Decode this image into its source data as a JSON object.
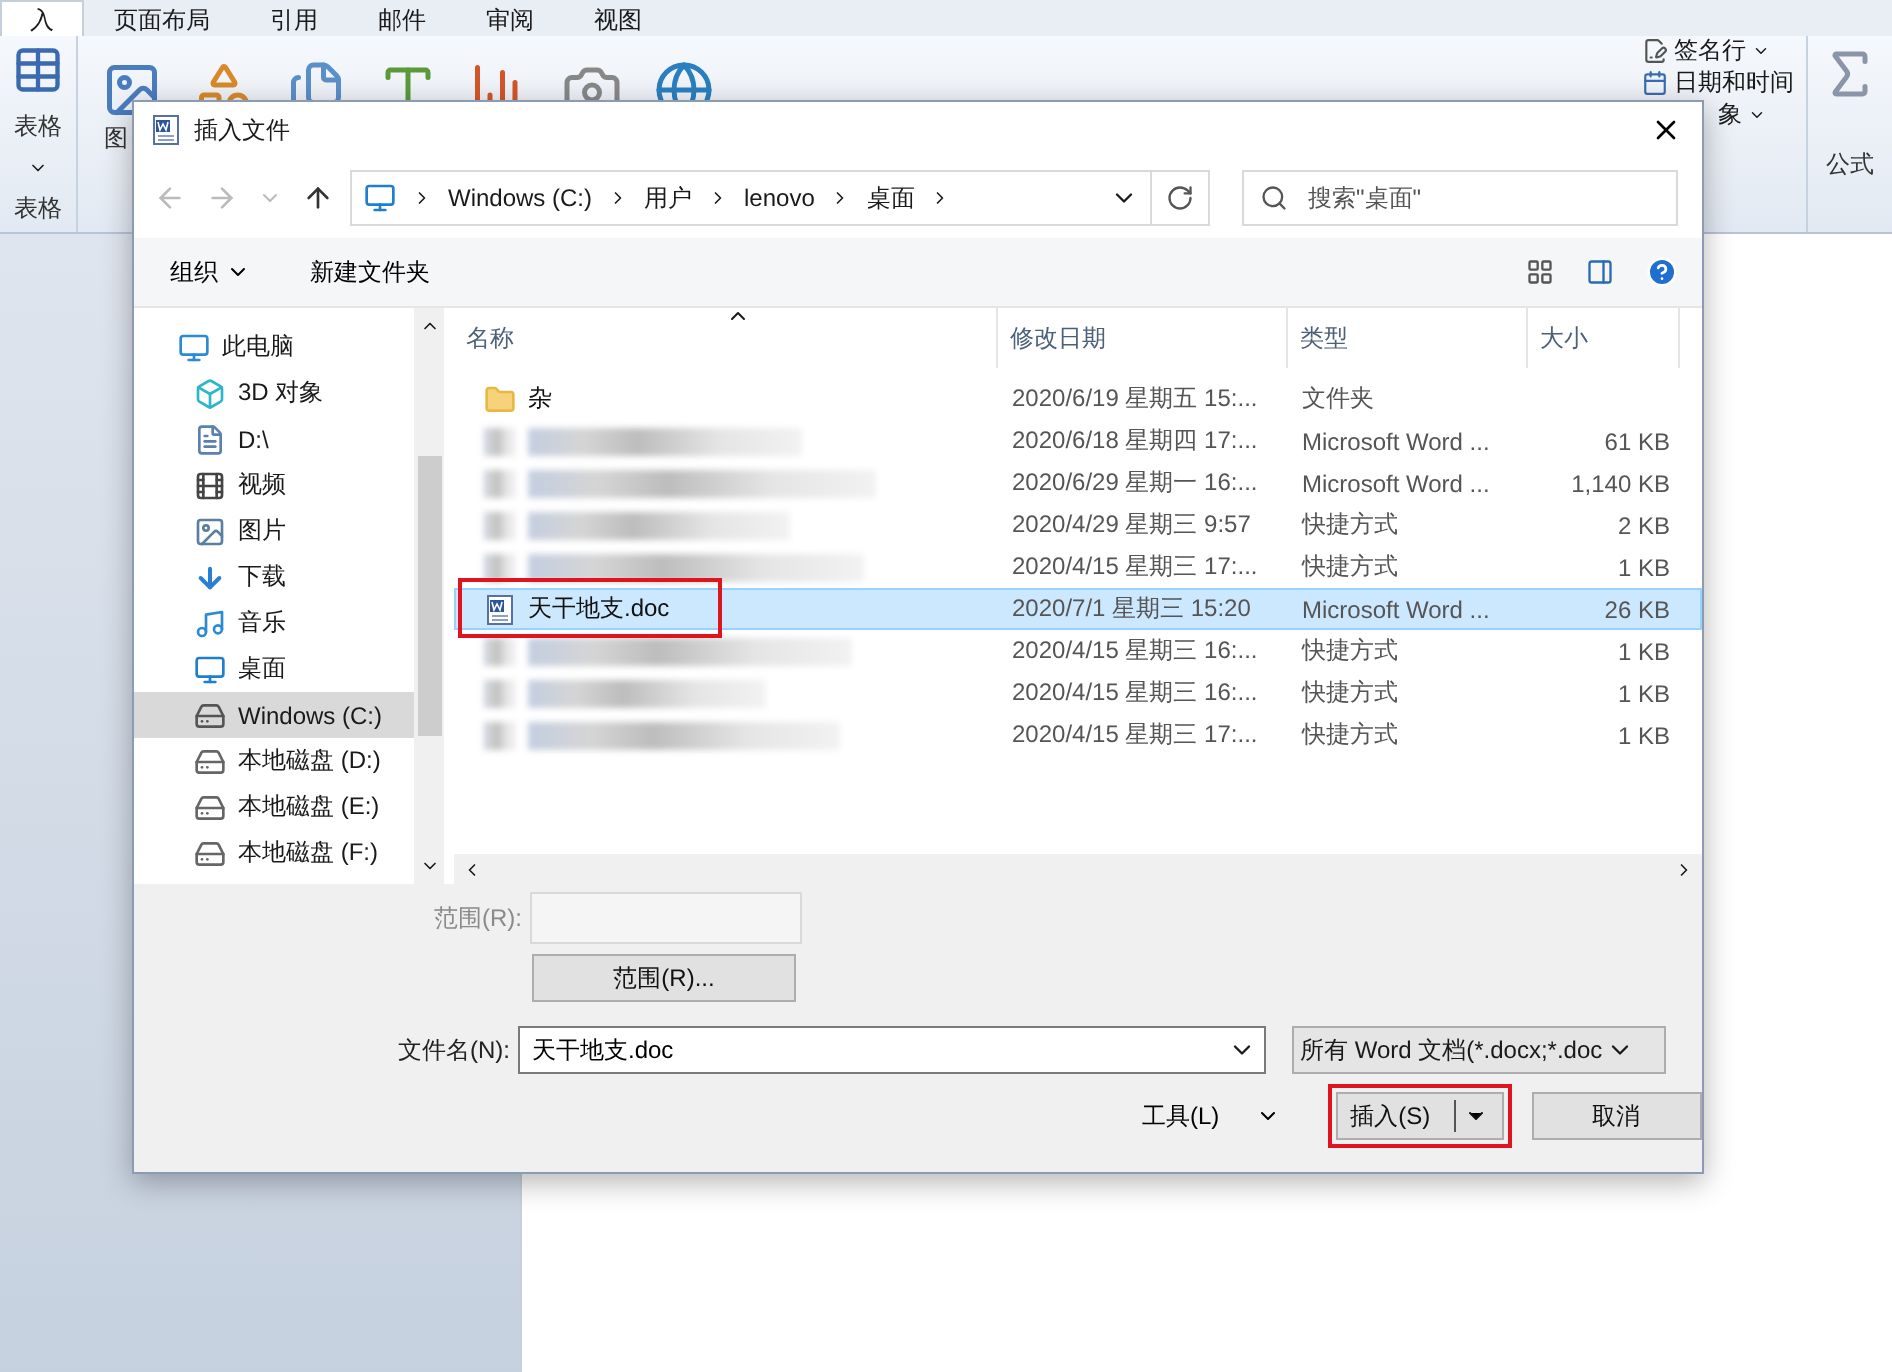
{
  "ribbon": {
    "tabs": [
      {
        "label": "入",
        "selected": true
      },
      {
        "label": "页面布局",
        "selected": false
      },
      {
        "label": "引用",
        "selected": false
      },
      {
        "label": "邮件",
        "selected": false
      },
      {
        "label": "审阅",
        "selected": false
      },
      {
        "label": "视图",
        "selected": false
      }
    ],
    "table_button": "表格",
    "table_group": "表格",
    "picture_label": "图",
    "signature": "签名行",
    "datetime": "日期和时间",
    "object": "象",
    "formula": "公式"
  },
  "dialog": {
    "title": "插入文件",
    "breadcrumbs": [
      "Windows (C:)",
      "用户",
      "lenovo",
      "桌面"
    ],
    "search": {
      "placeholder": "搜索\"桌面\""
    },
    "toolbar": {
      "organize": "组织",
      "new_folder": "新建文件夹"
    },
    "nav": [
      {
        "label": "此电脑",
        "kind": "pc",
        "selected": false
      },
      {
        "label": "3D 对象",
        "kind": "cube",
        "selected": false
      },
      {
        "label": "D:\\",
        "kind": "doc",
        "selected": false
      },
      {
        "label": "视频",
        "kind": "video",
        "selected": false
      },
      {
        "label": "图片",
        "kind": "picture",
        "selected": false
      },
      {
        "label": "下载",
        "kind": "download",
        "selected": false
      },
      {
        "label": "音乐",
        "kind": "music",
        "selected": false
      },
      {
        "label": "桌面",
        "kind": "desktop",
        "selected": false
      },
      {
        "label": "Windows (C:)",
        "kind": "system-drive",
        "selected": true
      },
      {
        "label": "本地磁盘 (D:)",
        "kind": "drive",
        "selected": false
      },
      {
        "label": "本地磁盘 (E:)",
        "kind": "drive",
        "selected": false
      },
      {
        "label": "本地磁盘 (F:)",
        "kind": "drive",
        "selected": false
      }
    ],
    "columns": [
      "名称",
      "修改日期",
      "类型",
      "大小"
    ],
    "rows": [
      {
        "kind": "folder",
        "name": "杂",
        "date": "2020/6/19 星期五 15:...",
        "type": "文件夹",
        "selected": false,
        "annotated": false
      },
      {
        "kind": "blurred",
        "date": "2020/6/18 星期四 17:...",
        "type": "Microsoft Word ...",
        "size": "61 KB",
        "selected": false,
        "annotated": false
      },
      {
        "kind": "blurred",
        "date": "2020/6/29 星期一 16:...",
        "type": "Microsoft Word ...",
        "size": "1,140 KB",
        "selected": false,
        "annotated": false
      },
      {
        "kind": "blurred",
        "date": "2020/4/29 星期三 9:57",
        "type": "快捷方式",
        "size": "2 KB",
        "selected": false,
        "annotated": false
      },
      {
        "kind": "blurred",
        "date": "2020/4/15 星期三 17:...",
        "type": "快捷方式",
        "size": "1 KB",
        "selected": false,
        "annotated": false
      },
      {
        "kind": "word",
        "name": "天干地支.doc",
        "date": "2020/7/1 星期三 15:20",
        "type": "Microsoft Word ...",
        "size": "26 KB",
        "selected": true,
        "annotated": true
      },
      {
        "kind": "blurred",
        "date": "2020/4/15 星期三 16:...",
        "type": "快捷方式",
        "size": "1 KB",
        "selected": false,
        "annotated": false
      },
      {
        "kind": "blurred",
        "date": "2020/4/15 星期三 16:...",
        "type": "快捷方式",
        "size": "1 KB",
        "selected": false,
        "annotated": false
      },
      {
        "kind": "blurred",
        "date": "2020/4/15 星期三 17:...",
        "type": "快捷方式",
        "size": "1 KB",
        "selected": false,
        "annotated": false
      }
    ],
    "range_label": "范围(R):",
    "range_button": "范围(R)...",
    "filename_label": "文件名(N):",
    "filename": "天干地支.doc",
    "filter": "所有 Word 文档(*.docx;*.doc",
    "tools": "工具(L)",
    "insert": {
      "label": "插入(S)",
      "annotated": true
    },
    "cancel": "取消"
  }
}
